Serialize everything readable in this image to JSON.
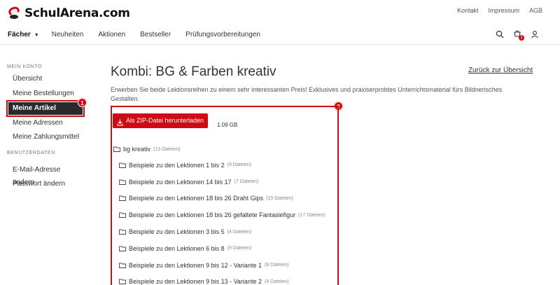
{
  "brand": {
    "name": "SchulArena.com",
    "accent": "#d10a11"
  },
  "toplinks": [
    "Kontakt",
    "Impressum",
    "AGB"
  ],
  "nav": {
    "items": [
      "Fächer",
      "Neuheiten",
      "Aktionen",
      "Bestseller",
      "Prüfungsvorbereitungen"
    ]
  },
  "header_icons": {
    "search": "search-icon",
    "cart": "cart-icon",
    "cart_badge": "1",
    "user": "user-icon"
  },
  "sidebar": {
    "heading1": "MEIN KONTO",
    "items1": [
      "Übersicht",
      "Meine Bestellungen",
      "Meine Artikel",
      "Meine Adressen",
      "Meine Zahlungsmittel"
    ],
    "heading2": "BENUTZERDATEN",
    "items2": [
      "E-Mail-Adresse ändern",
      "Passwort ändern"
    ]
  },
  "markers": {
    "m1": "1",
    "m2": "2"
  },
  "main": {
    "title": "Kombi: BG & Farben kreativ",
    "back_link": "Zurück zur Übersicht",
    "description": "Erwerben Sie beide Lektionsreihen zu einem sehr interessanten Preis! Exklusives und praxiserprobtes Unterrichtsmaterial fürs Bildnerisches Gestalten."
  },
  "download": {
    "label": "Als ZIP-Datei herunterladen",
    "size": "1.09 GB"
  },
  "tree": {
    "root": {
      "name": "bg kreativ",
      "count": "(13 Dateien)"
    },
    "children": [
      {
        "name": "Beispiele zu den Lektionen 1 bis 2",
        "count": "(9 Dateien)"
      },
      {
        "name": "Beispiele zu den Lektionen 14 bis 17",
        "count": "(7 Dateien)"
      },
      {
        "name": "Beispiele zu den Lektionen 18 bis 26 Draht Gips",
        "count": "(15 Dateien)"
      },
      {
        "name": "Beispiele zu den Lektionen 18 bis 26 gefaltete Fantasiefigur",
        "count": "(17 Dateien)"
      },
      {
        "name": "Beispiele zu den Lektionen 3 bis 5",
        "count": "(4 Dateien)"
      },
      {
        "name": "Beispiele zu den Lektionen 6 bis 8",
        "count": "(9 Dateien)"
      },
      {
        "name": "Beispiele zu den Lektionen 9 bis 12 - Variante 1",
        "count": "(8 Dateien)"
      },
      {
        "name": "Beispiele zu den Lektionen 9 bis 13 - Variante 2",
        "count": "(4 Dateien)"
      }
    ]
  }
}
